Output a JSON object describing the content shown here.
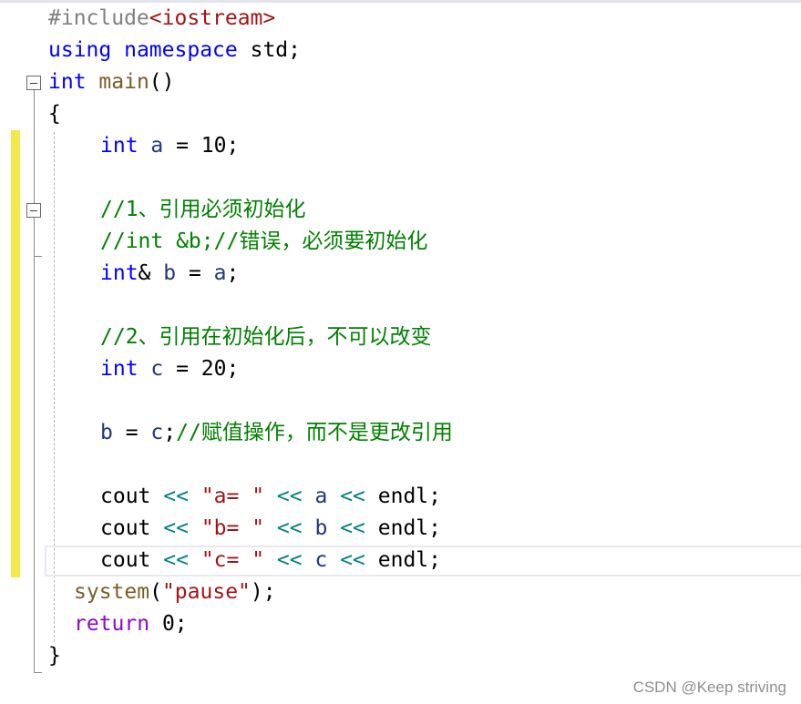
{
  "editor": {
    "lines": [
      {
        "parts": [
          "#include",
          "<iostream>"
        ]
      },
      {
        "parts": [
          "using",
          " ",
          "namespace",
          " ",
          "std",
          ";"
        ]
      },
      {
        "parts": [
          "int",
          " ",
          "main",
          "()"
        ]
      },
      {
        "parts": [
          "{"
        ]
      },
      {
        "parts": [
          "int",
          " ",
          "a",
          " = 10;"
        ]
      },
      {
        "parts": []
      },
      {
        "parts": [
          "//1、引用必须初始化"
        ]
      },
      {
        "parts": [
          "//int &b;//错误，必须要初始化"
        ]
      },
      {
        "parts": [
          "int",
          "& ",
          "b",
          " = ",
          "a",
          ";"
        ]
      },
      {
        "parts": []
      },
      {
        "parts": [
          "//2、引用在初始化后，不可以改变"
        ]
      },
      {
        "parts": [
          "int",
          " ",
          "c",
          " = 20;"
        ]
      },
      {
        "parts": []
      },
      {
        "parts": [
          "b",
          " = ",
          "c",
          ";",
          "//赋值操作，而不是更改引用"
        ]
      },
      {
        "parts": []
      },
      {
        "parts": [
          "cout",
          " ",
          "<<",
          " ",
          "\"a= \"",
          " ",
          "<<",
          " ",
          "a",
          " ",
          "<<",
          " ",
          "endl",
          ";"
        ]
      },
      {
        "parts": [
          "cout",
          " ",
          "<<",
          " ",
          "\"b= \"",
          " ",
          "<<",
          " ",
          "b",
          " ",
          "<<",
          " ",
          "endl",
          ";"
        ]
      },
      {
        "parts": [
          "cout",
          " ",
          "<<",
          " ",
          "\"c= \"",
          " ",
          "<<",
          " ",
          "c",
          " ",
          "<<",
          " ",
          "endl",
          ";"
        ]
      },
      {
        "parts": [
          "system",
          "(",
          "\"pause\"",
          ");"
        ]
      },
      {
        "parts": [
          "return",
          " 0;"
        ]
      },
      {
        "parts": [
          "}"
        ]
      }
    ]
  },
  "watermark": "CSDN @Keep striving",
  "colors": {
    "keyword": "#0000ff",
    "comment": "#008000",
    "string": "#a31515",
    "operator": "#008080",
    "variable": "#1f377f",
    "function": "#795e26",
    "return_keyword": "#8f08c4",
    "preprocessor": "#808080",
    "change_bar": "#f2e84a"
  },
  "icons": {
    "fold": "collapse-minus-icon"
  }
}
